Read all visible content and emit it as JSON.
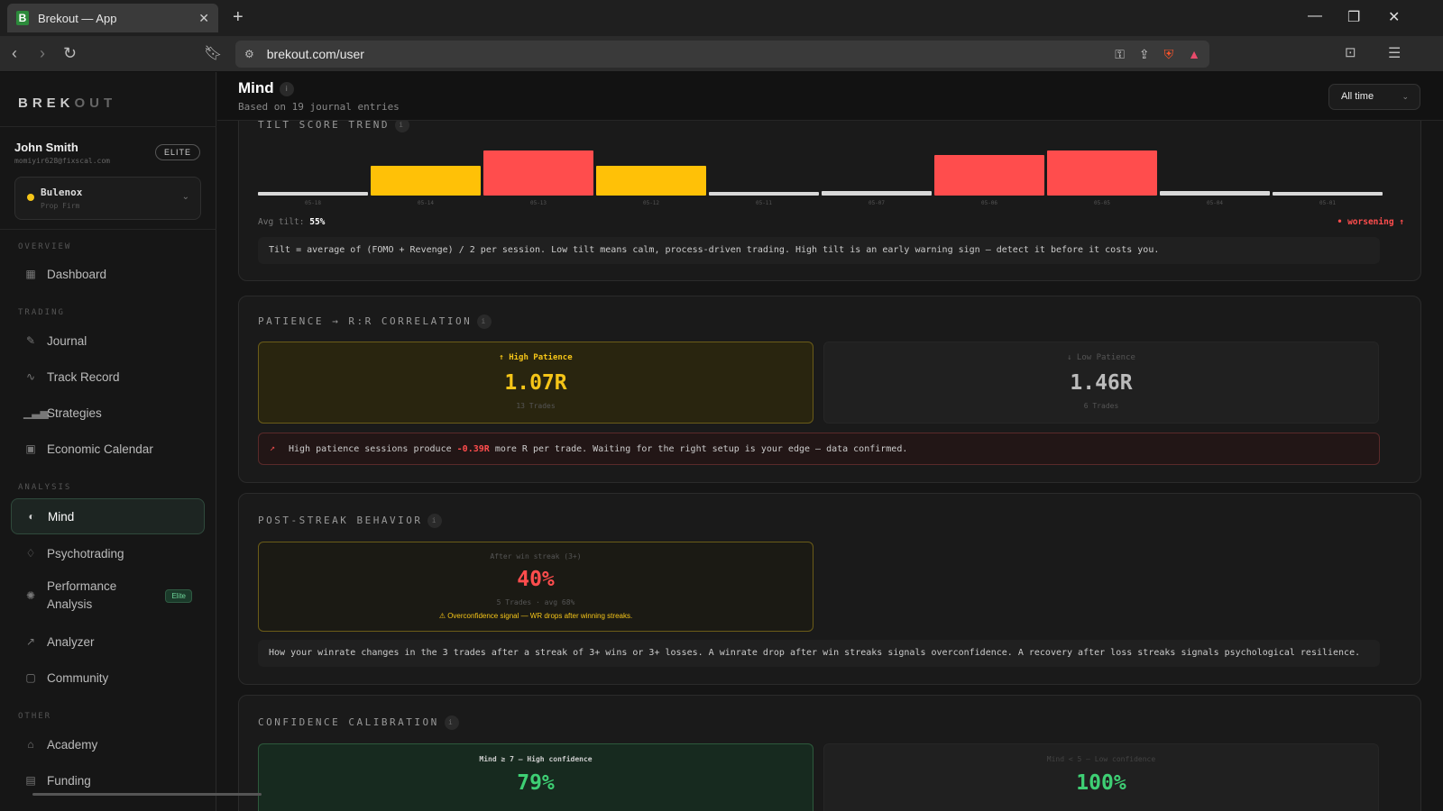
{
  "browser": {
    "tab_title": "Brekout — App",
    "favicon_letter": "B",
    "url": "brekout.com/user"
  },
  "sidebar": {
    "logo_main": "BREK",
    "logo_dim": "OUT",
    "user": {
      "name": "John Smith",
      "email": "momiyir628@fixscal.com",
      "badge": "ELITE"
    },
    "firm": {
      "name": "Bulenox",
      "type": "Prop Firm"
    },
    "sections": {
      "overview": "OVERVIEW",
      "trading": "TRADING",
      "analysis": "ANALYSIS",
      "other": "OTHER"
    },
    "items": {
      "dashboard": "Dashboard",
      "journal": "Journal",
      "track_record": "Track Record",
      "strategies": "Strategies",
      "economic_calendar": "Economic Calendar",
      "mind": "Mind",
      "psychotrading": "Psychotrading",
      "performance_line1": "Performance",
      "performance_line2": "Analysis",
      "performance_pill": "Elite",
      "analyzer": "Analyzer",
      "community": "Community",
      "academy": "Academy",
      "funding": "Funding"
    }
  },
  "header": {
    "title": "Mind",
    "subtitle": "Based on 19 journal entries",
    "range": "All time"
  },
  "tilt": {
    "title": "TILT SCORE TREND",
    "avg_label": "Avg tilt:",
    "avg_value": "55%",
    "trend": "• worsening ↑",
    "note": "Tilt = average of (FOMO + Revenge) / 2 per session. Low tilt means calm, process-driven trading. High tilt is an early warning sign — detect it before it costs you."
  },
  "chart_data": {
    "type": "bar",
    "categories": [
      "05-18",
      "05-14",
      "05-13",
      "05-12",
      "05-11",
      "05-07",
      "05-06",
      "05-05",
      "05-04",
      "05-01"
    ],
    "values": [
      7,
      66,
      100,
      66,
      5,
      10,
      90,
      100,
      10,
      6
    ],
    "colors": [
      "#d8d8d8",
      "#ffc107",
      "#ff4d4d",
      "#ffc107",
      "#d8d8d8",
      "#d8d8d8",
      "#ff4d4d",
      "#ff4d4d",
      "#d8d8d8",
      "#d8d8d8"
    ],
    "title": "TILT SCORE TREND",
    "ylim": [
      0,
      100
    ]
  },
  "patience": {
    "title": "PATIENCE → R:R CORRELATION",
    "high_label": "↑ High Patience",
    "high_value": "1.07R",
    "high_sub": "13 Trades",
    "low_label": "↓ Low Patience",
    "low_value": "1.46R",
    "low_sub": "6 Trades",
    "alert_pre": "High patience sessions produce",
    "alert_value": "-0.39R",
    "alert_post": "more R per trade. Waiting for the right setup is your edge — data confirmed."
  },
  "streak": {
    "title": "POST-STREAK BEHAVIOR",
    "label": "After win streak (3+)",
    "value": "40%",
    "sub": "5 Trades · avg 68%",
    "warning": "⚠ Overconfidence signal — WR drops after winning streaks.",
    "note": "How your winrate changes in the 3 trades after a streak of 3+ wins or 3+ losses. A winrate drop after win streaks signals overconfidence. A recovery after loss streaks signals psychological resilience."
  },
  "confidence": {
    "title": "CONFIDENCE CALIBRATION",
    "high_label": "Mind ≥ 7 — High confidence",
    "high_value": "79%",
    "low_label": "Mind < 5 — Low confidence",
    "low_value": "100%"
  },
  "colors": {
    "accent_green": "#2f4a3c",
    "tilt_high": "#ff4d4d",
    "tilt_mid": "#ffc107",
    "tilt_low": "#d8d8d8",
    "patience_gold": "#f5c518"
  }
}
